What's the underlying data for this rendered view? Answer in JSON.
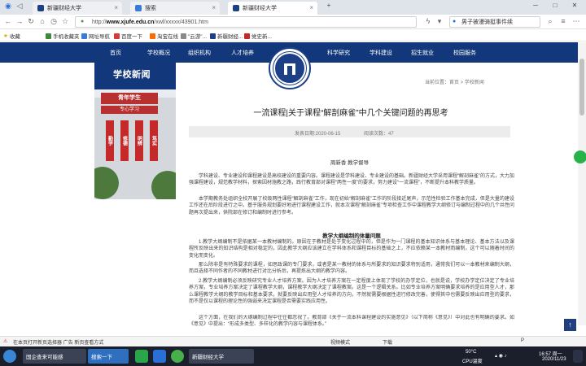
{
  "browser": {
    "tabs": [
      {
        "label": "新疆财经大学",
        "active": false
      },
      {
        "label": "搜索",
        "active": false
      },
      {
        "label": "新疆财经大学",
        "active": true
      }
    ],
    "url_prefix": "http://",
    "url_domain": "www.xjufe.edu.cn",
    "url_path": "/xwl/xxxxx/43901.htm",
    "search_placeholder": "男子被漫骑挺事件续",
    "bookmarks": [
      "收藏",
      "手机收藏夹",
      "网址导航",
      "百度一下",
      "淘宝在线",
      "\"云游\"...",
      "新疆财经...",
      "党史新..."
    ],
    "window_controls": [
      "─",
      "□",
      "✕"
    ]
  },
  "site": {
    "nav": [
      "首页",
      "学校概况",
      "组织机构",
      "人才培养",
      "科学研究",
      "学科建设",
      "招生就业",
      "校园服务"
    ],
    "section_title": "学校新闻",
    "breadcrumb": "当前位置：首页 > 学校新闻",
    "photo_banners": [
      "青年学生",
      "专心学习",
      "勤学",
      "修德",
      "明辨",
      "笃实"
    ]
  },
  "article": {
    "title": "一流课程|关于课程“解剖麻雀”中几个关键问题的再思考",
    "date": "发表日期:2020-06-15",
    "views": "阅读次数：47",
    "author": "周新香  教学督导",
    "paragraphs": [
      "学科建设、专业建设和课程建设是高校建设的重要内容。课程建设是学科建设、专业建设的基础。新疆财经大学采用课程“解剖麻雀”的方式，大力加强课程建设，规范教学材料，探索因材施教之路，践行教育部对课程“两性一度”的要求，努力建设“一流课程”，不断提升本科教学质量。",
      "本学期教务处组织全校开展了校级两性课程“解剖麻雀”工作，现在初始“解剖麻雀”工作的阶段接近尾声，示范性检验工作基本完成，但是大量的建设工作还在后阶段进行之中。基于服务规划要好地进行课程建设工作，就本次课程“解剖麻雀”专项检查工作中课程教学大纲修订与编制过程中的几个共性问题再次提出来，供院部在修订和编制时进行参考。"
    ],
    "subhead": "教学大纲编制的体量问题",
    "paragraphs2": [
      "1.教学大纲编制不是依据某一本教材编制的。原因在于教材是处于变化过程中的，但是作为一门课程的基本知识体系与基本理论、基本方法以及课程所反映出来的知识结构是相对稳定的，因此教学大纲应该建立在学科体系和课程目标的基础之上，不应依赖某一本教材而编制，这个可以随着时间的变化而变化。",
      "那么除非是有特殊要求的课程，如思政课的专门要求，或者是某一教材的体系与所要求的知识要求特别适用，通常我们可以一本教材来编制大纲，而且选择不同作者的不同教材进行对比分析后，再提炼出大纲的教学内容。",
      "2.教学大纲编制必须反映研究专业人才培养方案。因为人才培养方案在一定程度上体现了学校的办学定位，也就是说，学校办学定位决定了专业培养方案，专业培养方案决定了课程教学大纲，课程教学大纲决定了课程教案。这是一个逻辑关系。比如专业培养方案明确要求培养的是应用型人才，那么课程教学大纲的教学目标和基本要求，就要反映出应用型人才培养的方向，不然就需要根据性进行修改完善，使得其中也需要反映出应用型的要求，而不是仅以课程的理论性的强弱来决定课程是否需要实践应用性。",
      "这个方面，在我们的大纲编制过程中往往都忽视了。教育部《关于一流本科课程建设的实施意见》（以下简称《意见》）中对此也有明确的要求。如《意见》中提出：“形成多类型、多样化的教学内容与课程体系。”"
    ]
  },
  "statusbar": [
    "在本页打开新页选择器 广告 新页查看方式",
    "视频模式",
    "下载",
    "P"
  ],
  "taskbar": {
    "windows": [
      "国企查来可能感",
      "搜索一下",
      "新疆财经大学",
      ""
    ],
    "tray_temp": "50°C",
    "tray_cpu": "CPU温度",
    "time": "16:57 周一",
    "date": "2020/11/23"
  },
  "colors": {
    "nav_blue": "#12377a",
    "accent_red": "#c52a2a"
  }
}
